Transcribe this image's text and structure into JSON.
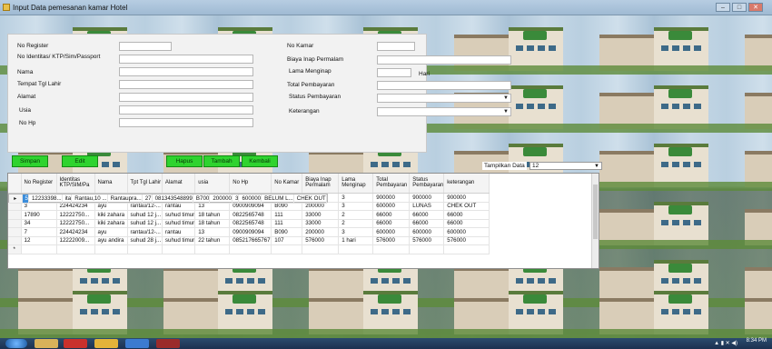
{
  "window": {
    "title": "Input Data pemesanan kamar Hotel"
  },
  "form": {
    "left": [
      {
        "label": "No Register",
        "value": ""
      },
      {
        "label": "No Identitas/ KTP/Sim/Passport",
        "value": ""
      },
      {
        "label": "Nama",
        "value": ""
      },
      {
        "label": "Tempat Tgl Lahir",
        "value": ""
      },
      {
        "label": "Alamat",
        "value": ""
      },
      {
        "label": "Usia",
        "value": ""
      },
      {
        "label": "No Hp",
        "value": ""
      }
    ],
    "right": [
      {
        "label": "No Kamar",
        "value": ""
      },
      {
        "label": "Biaya Inap Permalam",
        "value": ""
      },
      {
        "label": "Lama Menginap",
        "value": "",
        "suffix": "Hari"
      },
      {
        "label": "Total Pembayaran",
        "value": ""
      },
      {
        "label": "Status Pembayaran",
        "value": ""
      },
      {
        "label": "Keterangan",
        "value": ""
      }
    ]
  },
  "buttons": {
    "simpan": "Simpan",
    "edit": "Edit",
    "hapus": "Hapus",
    "tambah": "Tambah",
    "kembali": "Kembali"
  },
  "filter": {
    "label": "Tampilkan Data",
    "selected": "12"
  },
  "grid": {
    "columns": [
      "No Register",
      "Identitas KTP/SIM/Pa",
      "Nama",
      "Tpt Tgl Lahir",
      "Alamat",
      "usia",
      "No Hp",
      "No Kamar",
      "Biaya Inap Permalam",
      "Lama Menginap",
      "Total Pembayaran",
      "Status Pembayaran",
      "keterangan"
    ],
    "rows": [
      [
        "5",
        "12233398...",
        "ita",
        "Rantau,10 ...",
        "Rantaupra...",
        "27",
        "081343548899",
        "B700",
        "200000",
        "3",
        "600000",
        "BELUM L...",
        "CHEK OUT"
      ],
      [
        "4",
        "1222446...",
        "Dian",
        "Medan, 23...",
        "Sigambal",
        "26",
        "081345678765",
        "B077",
        "300000",
        "3",
        "900000",
        "900000",
        "900000"
      ],
      [
        "3",
        "224424234",
        "ayu",
        "rantau/12-...",
        "rantau",
        "13",
        "0900909094",
        "B090",
        "200000",
        "3",
        "600000",
        "LUNAS",
        "CHEK OUT"
      ],
      [
        "17890",
        "12222750...",
        "kiki zahara",
        "suhud 12 j...",
        "suhud timur",
        "18 tahun",
        "0822565748",
        "111",
        "33000",
        "2",
        "66000",
        "66000",
        "66000"
      ],
      [
        "34",
        "12222750...",
        "kiki zahara",
        "suhud 12 j...",
        "suhud timur",
        "18 tahun",
        "0822565748",
        "111",
        "33000",
        "2",
        "66000",
        "66000",
        "66000"
      ],
      [
        "7",
        "224424234",
        "ayu",
        "rantau/12-...",
        "rantau",
        "13",
        "0900909094",
        "B090",
        "200000",
        "3",
        "600000",
        "600000",
        "600000"
      ],
      [
        "12",
        "12222009...",
        "ayu andira",
        "suhud 28 j...",
        "suhud timur",
        "22 tahun",
        "085217665767",
        "107",
        "576000",
        "1 hari",
        "576000",
        "576000",
        "576000"
      ]
    ]
  },
  "taskbar": {
    "time": "8:34 PM"
  }
}
